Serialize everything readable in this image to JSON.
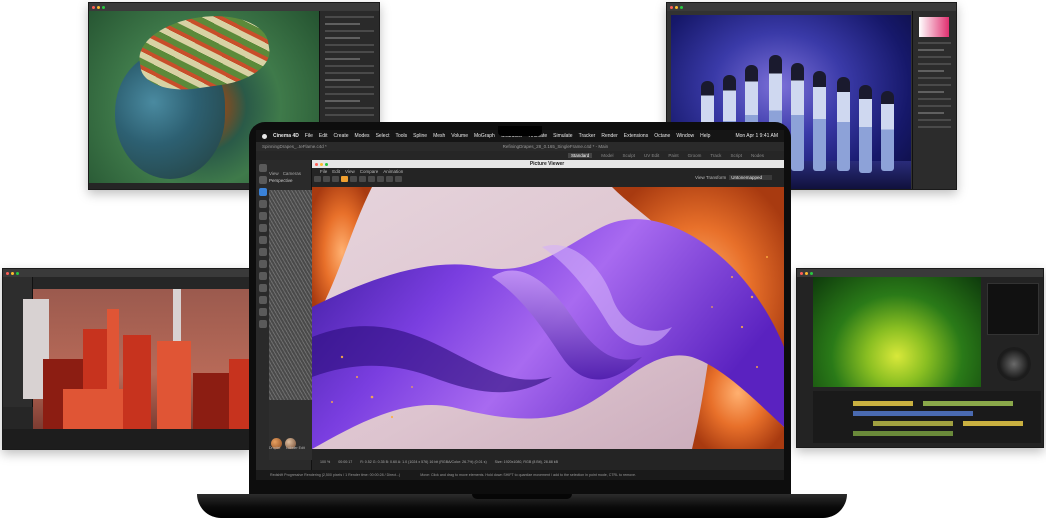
{
  "cinema4d": {
    "menu": [
      "Cinema 4D",
      "File",
      "Edit",
      "Create",
      "Modes",
      "Select",
      "Tools",
      "Spline",
      "Mesh",
      "Volume",
      "MoGraph",
      "Character",
      "Animate",
      "Simulate",
      "Tracker",
      "Render",
      "Extensions",
      "Octane",
      "Window",
      "Help"
    ],
    "clock": "Mon Apr 1  9:41 AM",
    "doc_tab": "SpinningDrapes_..teFlame.c4d *",
    "window_title": "RefiningDrapes_28_0.165_SingleFrame.c4d * - Main",
    "layouts": [
      "Standard",
      "Model",
      "Sculpt",
      "UV Edit",
      "Paint",
      "Groom",
      "Track",
      "Script",
      "Nodes"
    ],
    "viewport_menu": [
      "View",
      "Cameras"
    ],
    "viewport_label": "Perspective",
    "materials": [
      "Droplet",
      "Lobster Edit"
    ],
    "status_left": "Redshift Progressive Rendering (2,500 pixels / 1 Render time: 00:00:28 / Direct...)",
    "status_right": "Move: Click and drag to move elements. Hold down SHIFT to quantize movement / add to the selection in point mode, CTRL to remove."
  },
  "picture_viewer": {
    "title": "Picture Viewer",
    "menu": [
      "File",
      "Edit",
      "View",
      "Compare",
      "Animation"
    ],
    "view_transform_label": "View Transform",
    "view_transform_value": "Untonemapped",
    "zoom": "100 %",
    "time": "00:00:17",
    "info": "R: 0.52  G: 0.35  B: 0.60  A: 1.0  (1024 x 576)  16 bit  (RGBA/Color: 26.7%)  (0.01 s)",
    "size": "Size: 1920x1080, RGB (8 Bit), 28.88 kB"
  }
}
